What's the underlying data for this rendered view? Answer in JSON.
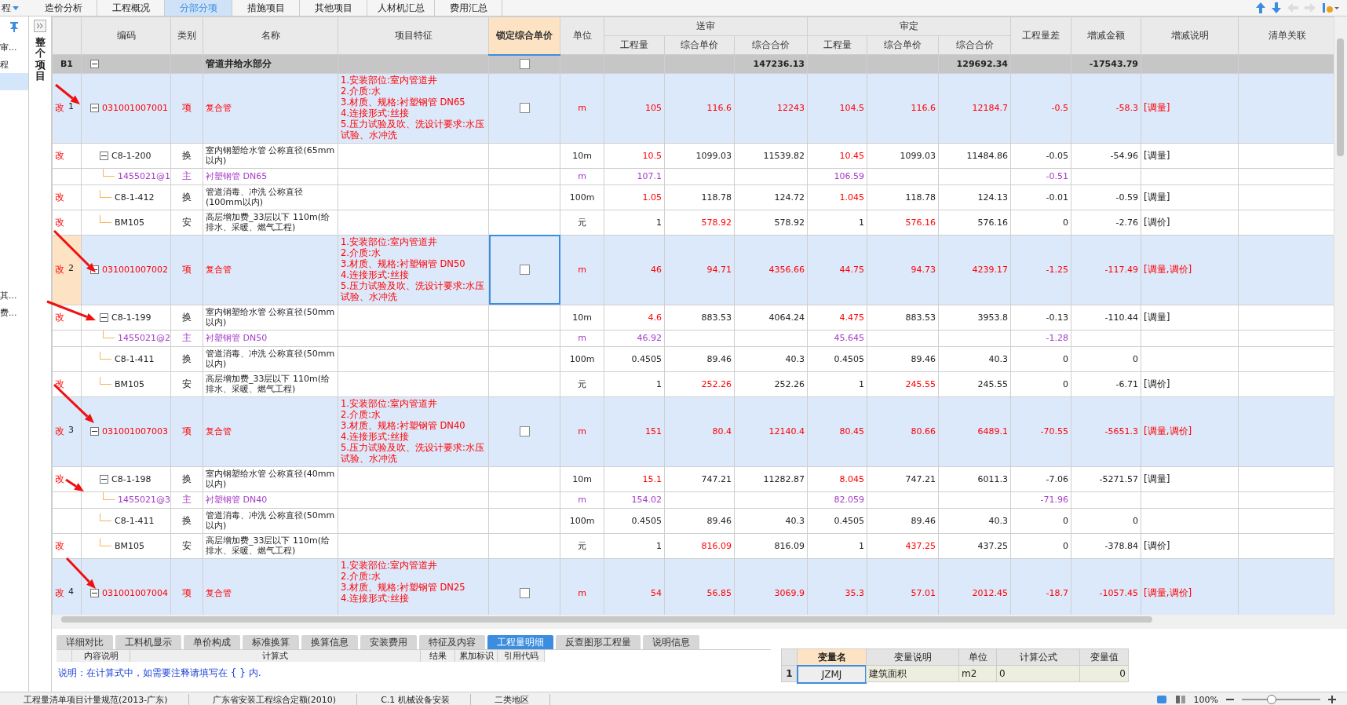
{
  "menu": {
    "label": "程"
  },
  "tabs": [
    {
      "label": "造价分析",
      "selected": false
    },
    {
      "label": "工程概况",
      "selected": false
    },
    {
      "label": "分部分项",
      "selected": true
    },
    {
      "label": "措施项目",
      "selected": false
    },
    {
      "label": "其他项目",
      "selected": false
    },
    {
      "label": "人材机汇总",
      "selected": false
    },
    {
      "label": "费用汇总",
      "selected": false
    }
  ],
  "sidebar": {
    "items": [
      {
        "label": "审...",
        "selected": false
      },
      {
        "label": "程",
        "selected": false
      },
      {
        "selected": true
      },
      {
        "label": "其...",
        "selected": false
      },
      {
        "label": "费...",
        "selected": false
      }
    ]
  },
  "panel": {
    "title": "整个项目"
  },
  "columns": [
    {
      "label": "编码",
      "selected": false
    },
    {
      "label": "类别",
      "selected": false
    },
    {
      "label": "名称",
      "selected": false
    },
    {
      "label": "项目特征",
      "selected": false
    },
    {
      "label": "锁定综合单价",
      "selected": true
    },
    {
      "label": "单位",
      "selected": false
    },
    {
      "label": "送审",
      "selected": false,
      "children": [
        "工程量",
        "综合单价",
        "综合合价"
      ]
    },
    {
      "label": "审定",
      "selected": false,
      "children": [
        "工程量",
        "综合单价",
        "综合合价"
      ]
    },
    {
      "label": "工程量差",
      "selected": false
    },
    {
      "label": "增减金额",
      "selected": false
    },
    {
      "label": "增减说明",
      "selected": false
    },
    {
      "label": "清单关联",
      "selected": false
    }
  ],
  "rows": [
    {
      "kind": "section",
      "num": "B1",
      "expanded": true,
      "name": "管道井给水部分",
      "locked": false,
      "values": {
        "sent_total": {
          "text": "147236.13",
          "changed": false
        },
        "approved_total": {
          "text": "129692.34",
          "changed": false
        },
        "delta": {
          "text": "-17543.79",
          "changed": false
        }
      }
    },
    {
      "kind": "item",
      "mark": "改",
      "num": "1",
      "selected": false,
      "expanded": true,
      "code": "031001007001",
      "type": "项",
      "name": "复合管",
      "features": [
        "1.安装部位:室内管道井",
        "2.介质:水",
        "3.材质、规格:衬塑钢管 DN65",
        "4.连接形式:丝接",
        "5.压力试验及吹、洗设计要求:水压试验、水冲洗"
      ],
      "locked": false,
      "unit": "m",
      "values": {
        "sent_qty": {
          "text": "105",
          "changed": true
        },
        "sent_price": {
          "text": "116.6",
          "changed": true
        },
        "sent_total": {
          "text": "12243",
          "changed": true
        },
        "approved_qty": {
          "text": "104.5",
          "changed": true
        },
        "approved_price": {
          "text": "116.6",
          "changed": true
        },
        "approved_total": {
          "text": "12184.7",
          "changed": true
        },
        "qty_diff": {
          "text": "-0.5",
          "changed": true
        },
        "delta": {
          "text": "-58.3",
          "changed": true
        },
        "note": {
          "text": "[调量]",
          "changed": true
        }
      }
    },
    {
      "kind": "sub",
      "mark": "改",
      "expanded": true,
      "code": "C8-1-200",
      "type": "换",
      "name": "室内钢塑给水管 公称直径(65mm以内)",
      "unit": "10m",
      "values": {
        "sent_qty": {
          "text": "10.5",
          "changed": true
        },
        "sent_price": {
          "text": "1099.03",
          "changed": false
        },
        "sent_total": {
          "text": "11539.82",
          "changed": false
        },
        "approved_qty": {
          "text": "10.45",
          "changed": true
        },
        "approved_price": {
          "text": "1099.03",
          "changed": false
        },
        "approved_total": {
          "text": "11484.86",
          "changed": false
        },
        "qty_diff": {
          "text": "-0.05",
          "changed": false
        },
        "delta": {
          "text": "-54.96",
          "changed": false
        },
        "note": {
          "text": "[调量]",
          "changed": false
        }
      }
    },
    {
      "kind": "main",
      "code": "1455021@1",
      "type": "主",
      "name": "衬塑钢管 DN65",
      "unit": "m",
      "values": {
        "sent_qty": {
          "text": "107.1",
          "changed": false
        },
        "approved_qty": {
          "text": "106.59",
          "changed": false
        },
        "qty_diff": {
          "text": "-0.51",
          "changed": false
        }
      }
    },
    {
      "kind": "sub",
      "mark": "改",
      "code": "C8-1-412",
      "type": "换",
      "name": "管道消毒、冲洗 公称直径(100mm以内)",
      "unit": "100m",
      "values": {
        "sent_qty": {
          "text": "1.05",
          "changed": true
        },
        "sent_price": {
          "text": "118.78",
          "changed": false
        },
        "sent_total": {
          "text": "124.72",
          "changed": false
        },
        "approved_qty": {
          "text": "1.045",
          "changed": true
        },
        "approved_price": {
          "text": "118.78",
          "changed": false
        },
        "approved_total": {
          "text": "124.13",
          "changed": false
        },
        "qty_diff": {
          "text": "-0.01",
          "changed": false
        },
        "delta": {
          "text": "-0.59",
          "changed": false
        },
        "note": {
          "text": "[调量]",
          "changed": false
        }
      }
    },
    {
      "kind": "sub",
      "mark": "改",
      "code": "BM105",
      "type": "安",
      "name": "高层增加费_33层以下 110m(给排水、采暖、燃气工程)",
      "unit": "元",
      "values": {
        "sent_qty": {
          "text": "1",
          "changed": false
        },
        "sent_price": {
          "text": "578.92",
          "changed": true
        },
        "sent_total": {
          "text": "578.92",
          "changed": false
        },
        "approved_qty": {
          "text": "1",
          "changed": false
        },
        "approved_price": {
          "text": "576.16",
          "changed": true
        },
        "approved_total": {
          "text": "576.16",
          "changed": false
        },
        "qty_diff": {
          "text": "0",
          "changed": false
        },
        "delta": {
          "text": "-2.76",
          "changed": false
        },
        "note": {
          "text": "[调价]",
          "changed": false
        }
      }
    },
    {
      "kind": "item",
      "mark": "改",
      "num": "2",
      "selected": true,
      "expanded": true,
      "code": "031001007002",
      "type": "项",
      "name": "复合管",
      "features": [
        "1.安装部位:室内管道井",
        "2.介质:水",
        "3.材质、规格:衬塑钢管 DN50",
        "4.连接形式:丝接",
        "5.压力试验及吹、洗设计要求:水压试验、水冲洗"
      ],
      "locked": false,
      "unit": "m",
      "values": {
        "sent_qty": {
          "text": "46",
          "changed": true
        },
        "sent_price": {
          "text": "94.71",
          "changed": true
        },
        "sent_total": {
          "text": "4356.66",
          "changed": true
        },
        "approved_qty": {
          "text": "44.75",
          "changed": true
        },
        "approved_price": {
          "text": "94.73",
          "changed": true
        },
        "approved_total": {
          "text": "4239.17",
          "changed": true
        },
        "qty_diff": {
          "text": "-1.25",
          "changed": true
        },
        "delta": {
          "text": "-117.49",
          "changed": true
        },
        "note": {
          "text": "[调量,调价]",
          "changed": true
        }
      }
    },
    {
      "kind": "sub",
      "mark": "改",
      "expanded": true,
      "code": "C8-1-199",
      "type": "换",
      "name": "室内钢塑给水管 公称直径(50mm以内)",
      "unit": "10m",
      "values": {
        "sent_qty": {
          "text": "4.6",
          "changed": true
        },
        "sent_price": {
          "text": "883.53",
          "changed": false
        },
        "sent_total": {
          "text": "4064.24",
          "changed": false
        },
        "approved_qty": {
          "text": "4.475",
          "changed": true
        },
        "approved_price": {
          "text": "883.53",
          "changed": false
        },
        "approved_total": {
          "text": "3953.8",
          "changed": false
        },
        "qty_diff": {
          "text": "-0.13",
          "changed": false
        },
        "delta": {
          "text": "-110.44",
          "changed": false
        },
        "note": {
          "text": "[调量]",
          "changed": false
        }
      }
    },
    {
      "kind": "main",
      "code": "1455021@2",
      "type": "主",
      "name": "衬塑钢管 DN50",
      "unit": "m",
      "values": {
        "sent_qty": {
          "text": "46.92",
          "changed": false
        },
        "approved_qty": {
          "text": "45.645",
          "changed": false
        },
        "qty_diff": {
          "text": "-1.28",
          "changed": false
        }
      }
    },
    {
      "kind": "sub",
      "code": "C8-1-411",
      "type": "换",
      "name": "管道消毒、冲洗 公称直径(50mm以内)",
      "unit": "100m",
      "values": {
        "sent_qty": {
          "text": "0.4505",
          "changed": false
        },
        "sent_price": {
          "text": "89.46",
          "changed": false
        },
        "sent_total": {
          "text": "40.3",
          "changed": false
        },
        "approved_qty": {
          "text": "0.4505",
          "changed": false
        },
        "approved_price": {
          "text": "89.46",
          "changed": false
        },
        "approved_total": {
          "text": "40.3",
          "changed": false
        },
        "qty_diff": {
          "text": "0",
          "changed": false
        },
        "delta": {
          "text": "0",
          "changed": false
        }
      }
    },
    {
      "kind": "sub",
      "mark": "改",
      "code": "BM105",
      "type": "安",
      "name": "高层增加费_33层以下 110m(给排水、采暖、燃气工程)",
      "unit": "元",
      "values": {
        "sent_qty": {
          "text": "1",
          "changed": false
        },
        "sent_price": {
          "text": "252.26",
          "changed": true
        },
        "sent_total": {
          "text": "252.26",
          "changed": false
        },
        "approved_qty": {
          "text": "1",
          "changed": false
        },
        "approved_price": {
          "text": "245.55",
          "changed": true
        },
        "approved_total": {
          "text": "245.55",
          "changed": false
        },
        "qty_diff": {
          "text": "0",
          "changed": false
        },
        "delta": {
          "text": "-6.71",
          "changed": false
        },
        "note": {
          "text": "[调价]",
          "changed": false
        }
      }
    },
    {
      "kind": "item",
      "mark": "改",
      "num": "3",
      "selected": false,
      "expanded": true,
      "code": "031001007003",
      "type": "项",
      "name": "复合管",
      "features": [
        "1.安装部位:室内管道井",
        "2.介质:水",
        "3.材质、规格:衬塑钢管 DN40",
        "4.连接形式:丝接",
        "5.压力试验及吹、洗设计要求:水压试验、水冲洗"
      ],
      "locked": false,
      "unit": "m",
      "values": {
        "sent_qty": {
          "text": "151",
          "changed": true
        },
        "sent_price": {
          "text": "80.4",
          "changed": true
        },
        "sent_total": {
          "text": "12140.4",
          "changed": true
        },
        "approved_qty": {
          "text": "80.45",
          "changed": true
        },
        "approved_price": {
          "text": "80.66",
          "changed": true
        },
        "approved_total": {
          "text": "6489.1",
          "changed": true
        },
        "qty_diff": {
          "text": "-70.55",
          "changed": true
        },
        "delta": {
          "text": "-5651.3",
          "changed": true
        },
        "note": {
          "text": "[调量,调价]",
          "changed": true
        }
      }
    },
    {
      "kind": "sub",
      "mark": "改",
      "expanded": true,
      "code": "C8-1-198",
      "type": "换",
      "name": "室内钢塑给水管 公称直径(40mm以内)",
      "unit": "10m",
      "values": {
        "sent_qty": {
          "text": "15.1",
          "changed": true
        },
        "sent_price": {
          "text": "747.21",
          "changed": false
        },
        "sent_total": {
          "text": "11282.87",
          "changed": false
        },
        "approved_qty": {
          "text": "8.045",
          "changed": true
        },
        "approved_price": {
          "text": "747.21",
          "changed": false
        },
        "approved_total": {
          "text": "6011.3",
          "changed": false
        },
        "qty_diff": {
          "text": "-7.06",
          "changed": false
        },
        "delta": {
          "text": "-5271.57",
          "changed": false
        },
        "note": {
          "text": "[调量]",
          "changed": false
        }
      }
    },
    {
      "kind": "main",
      "code": "1455021@3",
      "type": "主",
      "name": "衬塑钢管 DN40",
      "unit": "m",
      "values": {
        "sent_qty": {
          "text": "154.02",
          "changed": false
        },
        "approved_qty": {
          "text": "82.059",
          "changed": false
        },
        "qty_diff": {
          "text": "-71.96",
          "changed": false
        }
      }
    },
    {
      "kind": "sub",
      "code": "C8-1-411",
      "type": "换",
      "name": "管道消毒、冲洗 公称直径(50mm以内)",
      "unit": "100m",
      "values": {
        "sent_qty": {
          "text": "0.4505",
          "changed": false
        },
        "sent_price": {
          "text": "89.46",
          "changed": false
        },
        "sent_total": {
          "text": "40.3",
          "changed": false
        },
        "approved_qty": {
          "text": "0.4505",
          "changed": false
        },
        "approved_price": {
          "text": "89.46",
          "changed": false
        },
        "approved_total": {
          "text": "40.3",
          "changed": false
        },
        "qty_diff": {
          "text": "0",
          "changed": false
        },
        "delta": {
          "text": "0",
          "changed": false
        }
      }
    },
    {
      "kind": "sub",
      "mark": "改",
      "code": "BM105",
      "type": "安",
      "name": "高层增加费_33层以下 110m(给排水、采暖、燃气工程)",
      "unit": "元",
      "values": {
        "sent_qty": {
          "text": "1",
          "changed": false
        },
        "sent_price": {
          "text": "816.09",
          "changed": true
        },
        "sent_total": {
          "text": "816.09",
          "changed": false
        },
        "approved_qty": {
          "text": "1",
          "changed": false
        },
        "approved_price": {
          "text": "437.25",
          "changed": true
        },
        "approved_total": {
          "text": "437.25",
          "changed": false
        },
        "qty_diff": {
          "text": "0",
          "changed": false
        },
        "delta": {
          "text": "-378.84",
          "changed": false
        },
        "note": {
          "text": "[调价]",
          "changed": false
        }
      }
    },
    {
      "kind": "item",
      "mark": "改",
      "num": "4",
      "selected": false,
      "expanded": true,
      "code": "031001007004",
      "type": "项",
      "name": "复合管",
      "features": [
        "1.安装部位:室内管道井",
        "2.介质:水",
        "3.材质、规格:衬塑钢管 DN25",
        "4.连接形式:丝接"
      ],
      "locked": false,
      "unit": "m",
      "values": {
        "sent_qty": {
          "text": "54",
          "changed": true
        },
        "sent_price": {
          "text": "56.85",
          "changed": true
        },
        "sent_total": {
          "text": "3069.9",
          "changed": true
        },
        "approved_qty": {
          "text": "35.3",
          "changed": true
        },
        "approved_price": {
          "text": "57.01",
          "changed": true
        },
        "approved_total": {
          "text": "2012.45",
          "changed": true
        },
        "qty_diff": {
          "text": "-18.7",
          "changed": true
        },
        "delta": {
          "text": "-1057.45",
          "changed": true
        },
        "note": {
          "text": "[调量,调价]",
          "changed": true
        }
      }
    }
  ],
  "bottom_tabs": [
    {
      "label": "详细对比",
      "selected": false
    },
    {
      "label": "工料机显示",
      "selected": false
    },
    {
      "label": "单价构成",
      "selected": false
    },
    {
      "label": "标准换算",
      "selected": false
    },
    {
      "label": "换算信息",
      "selected": false
    },
    {
      "label": "安装费用",
      "selected": false
    },
    {
      "label": "特征及内容",
      "selected": false
    },
    {
      "label": "工程量明细",
      "selected": true
    },
    {
      "label": "反查图形工程量",
      "selected": false
    },
    {
      "label": "说明信息",
      "selected": false
    }
  ],
  "formula_table": {
    "columns": [
      "内容说明",
      "计算式",
      "结果",
      "累加标识",
      "引用代码"
    ],
    "note": "说明：在计算式中，如需要注释请填写在 { } 内."
  },
  "variable_table": {
    "columns": [
      "变量名",
      "变量说明",
      "单位",
      "计算公式",
      "变量值"
    ],
    "rows": [
      {
        "num": "1",
        "cells": [
          "JZMJ",
          "建筑面积",
          "m2",
          "0",
          "0"
        ]
      }
    ]
  },
  "status_bar": {
    "items": [
      "工程量清单项目计量规范(2013-广东)",
      "广东省安装工程综合定额(2010)",
      "C.1 机械设备安装",
      "二类地区"
    ],
    "zoom": {
      "label": "100%",
      "level": 0.37
    }
  }
}
